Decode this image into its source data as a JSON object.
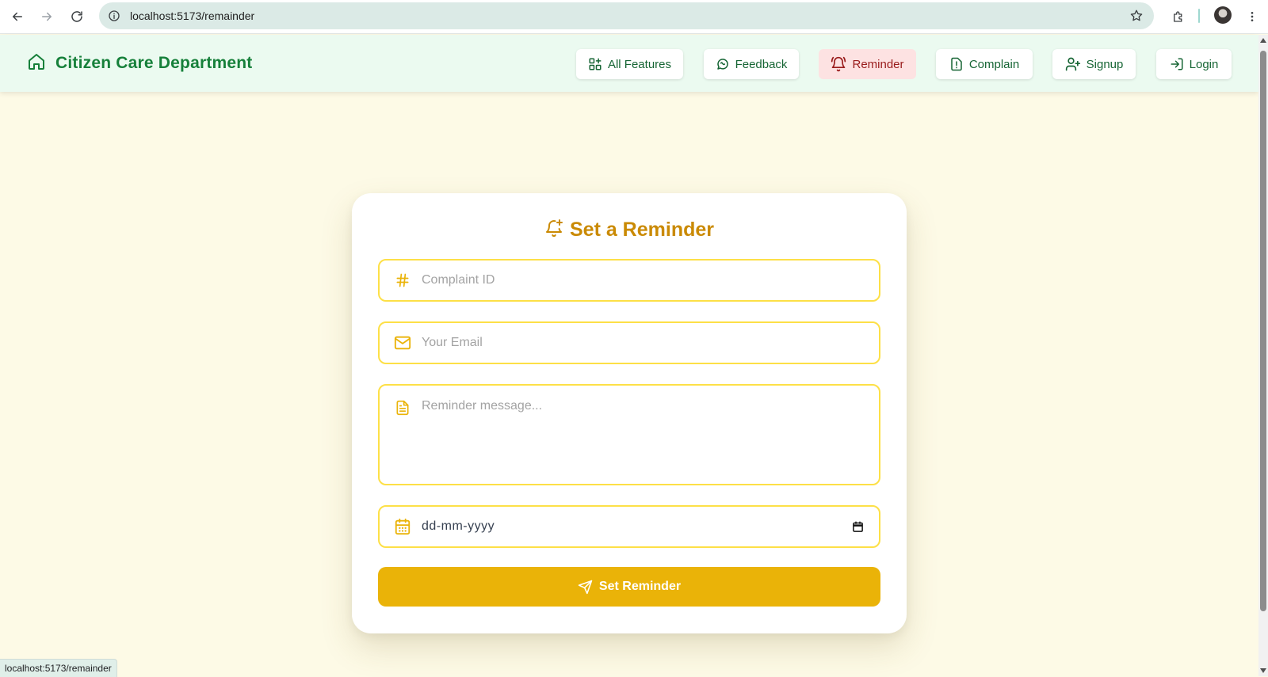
{
  "browser": {
    "url": "localhost:5173/remainder",
    "status_url": "localhost:5173/remainder"
  },
  "header": {
    "title": "Citizen Care Department",
    "nav": [
      {
        "label": "All Features",
        "icon": "grid-plus-icon"
      },
      {
        "label": "Feedback",
        "icon": "message-circle-icon"
      },
      {
        "label": "Reminder",
        "icon": "bell-ring-icon",
        "active": true
      },
      {
        "label": "Complain",
        "icon": "file-alert-icon"
      },
      {
        "label": "Signup",
        "icon": "user-plus-icon"
      },
      {
        "label": "Login",
        "icon": "log-in-icon"
      }
    ]
  },
  "form": {
    "title": "Set a Reminder",
    "complaint_id_placeholder": "Complaint ID",
    "email_placeholder": "Your Email",
    "message_placeholder": "Reminder message...",
    "date_value": "dd-mm-yyyy",
    "submit_label": "Set Reminder"
  },
  "colors": {
    "header_bg": "#ebfaf0",
    "brand_green": "#16803a",
    "accent_yellow": "#eab308",
    "title_gold": "#ca8a04",
    "active_nav_bg": "#fde2e2",
    "page_bg": "#fdfae6"
  }
}
